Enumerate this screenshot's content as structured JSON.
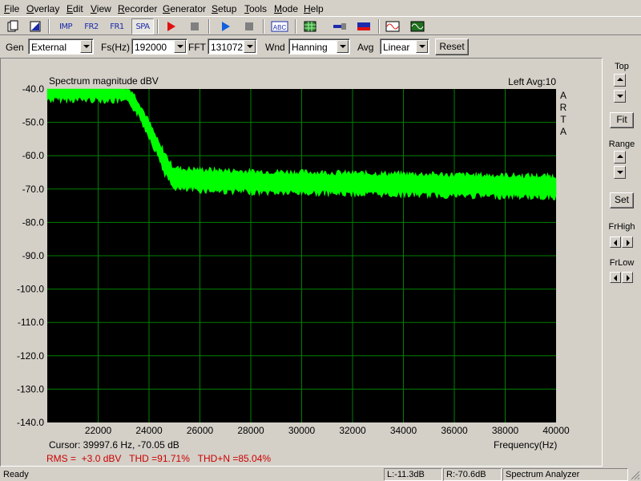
{
  "menu": [
    "File",
    "Overlay",
    "Edit",
    "View",
    "Recorder",
    "Generator",
    "Setup",
    "Tools",
    "Mode",
    "Help"
  ],
  "menu_hotkeys": [
    "F",
    "O",
    "E",
    "V",
    "R",
    "G",
    "S",
    "T",
    "M",
    "H"
  ],
  "toolbar": {
    "imp": "IMP",
    "fr2": "FR2",
    "fr1": "FR1",
    "spa": "SPA",
    "abc": "ABC"
  },
  "settings": {
    "gen_label": "Gen",
    "gen_value": "External",
    "fs_label": "Fs(Hz)",
    "fs_value": "192000",
    "fft_label": "FFT",
    "fft_value": "131072",
    "wnd_label": "Wnd",
    "wnd_value": "Hanning",
    "avg_label": "Avg",
    "avg_value": "Linear",
    "reset_label": "Reset"
  },
  "plot": {
    "title": "Spectrum magnitude dBV",
    "channel_info": "Left  Avg:10",
    "watermark": [
      "A",
      "R",
      "T",
      "A"
    ],
    "cursor_text": "Cursor: 39997.6 Hz, -70.05 dB",
    "rms_text": "RMS =  +3.0 dBV   THD =91.71%   THD+N =85.04%",
    "colors": {
      "background": "#000000",
      "grid": "#008000",
      "trace": "#00ff00",
      "rms": "#cc0000"
    }
  },
  "right_panel": {
    "top_label": "Top",
    "fit_label": "Fit",
    "range_label": "Range",
    "set_label": "Set",
    "frhigh_label": "FrHigh",
    "frlow_label": "FrLow"
  },
  "status": {
    "ready": "Ready",
    "left_level": "L:-11.3dB",
    "right_level": "R:-70.6dB",
    "mode": "Spectrum Analyzer"
  },
  "chart_data": {
    "type": "line",
    "title": "Spectrum magnitude dBV",
    "xlabel": "Frequency(Hz)",
    "ylabel": "",
    "xlim": [
      20000,
      40000
    ],
    "ylim": [
      -140,
      -40
    ],
    "x_ticks": [
      22000,
      24000,
      26000,
      28000,
      30000,
      32000,
      34000,
      36000,
      38000,
      40000
    ],
    "y_ticks": [
      "-40.0",
      "-50.0",
      "-60.0",
      "-70.0",
      "-80.0",
      "-90.0",
      "-100.0",
      "-110.0",
      "-120.0",
      "-130.0",
      "-140.0"
    ],
    "grid": true,
    "series": [
      {
        "name": "Left",
        "x": [
          20000,
          21000,
          22000,
          23000,
          23300,
          23600,
          24000,
          24300,
          24600,
          24900,
          25200,
          26000,
          27000,
          28000,
          30000,
          32000,
          34000,
          36000,
          38000,
          40000
        ],
        "y": [
          -41,
          -41,
          -41,
          -41.5,
          -42.5,
          -46,
          -52,
          -57,
          -62,
          -66,
          -67,
          -67.2,
          -67.5,
          -67.8,
          -68,
          -68.3,
          -68.5,
          -68.8,
          -69,
          -69.2
        ]
      }
    ]
  }
}
